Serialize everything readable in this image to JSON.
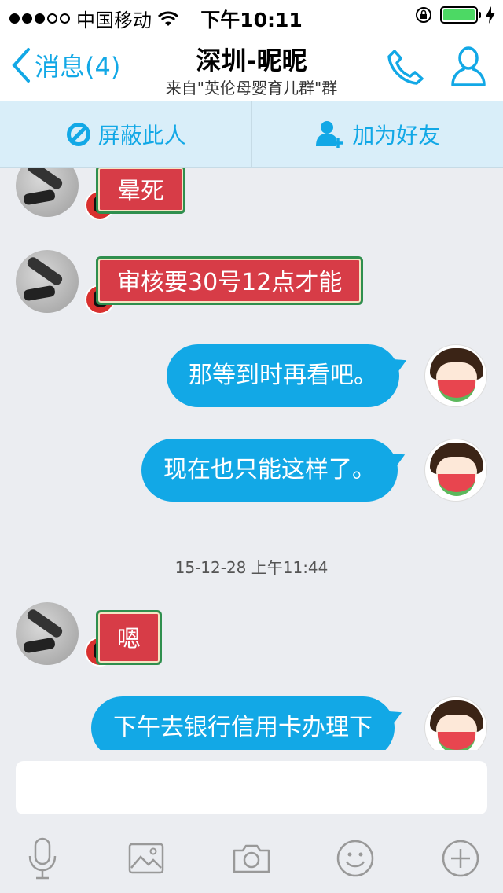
{
  "status_bar": {
    "carrier": "中国移动",
    "time": "下午10:11"
  },
  "nav": {
    "back_label": "消息(4)",
    "title": "深圳-昵昵",
    "subtitle": "来自\"英伦母婴育儿群\"群"
  },
  "actions": {
    "block_label": "屏蔽此人",
    "add_friend_label": "加为好友"
  },
  "messages": [
    {
      "side": "left",
      "text": "晕死"
    },
    {
      "side": "left",
      "text": "审核要30号12点才能"
    },
    {
      "side": "right",
      "text": "那等到时再看吧。"
    },
    {
      "side": "right",
      "text": "现在也只能这样了。"
    },
    {
      "side": "left",
      "text": "嗯"
    },
    {
      "side": "right",
      "text": "下午去银行信用卡办理下"
    }
  ],
  "timestamp": "15-12-28 上午11:44",
  "input": {
    "placeholder": ""
  },
  "toolbar_icons": [
    "microphone-icon",
    "image-icon",
    "camera-icon",
    "emoji-icon",
    "plus-icon"
  ],
  "colors": {
    "accent": "#12a8e6",
    "action_bar_bg": "#d9eef9",
    "chat_bg": "#ebedf1",
    "left_bubble": "#d73c47",
    "right_bubble": "#12a8e6"
  }
}
